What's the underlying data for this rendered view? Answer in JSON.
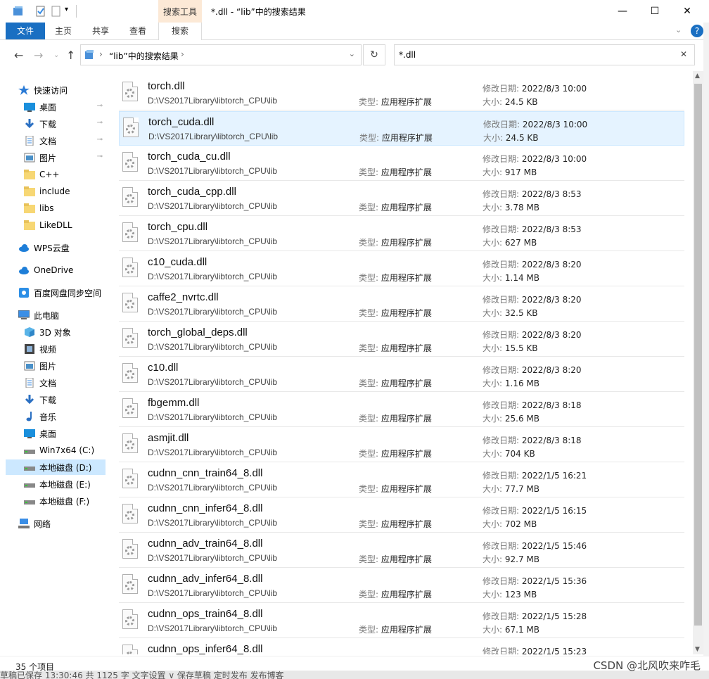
{
  "window": {
    "title": "*.dll - “lib”中的搜索结果",
    "context_tab": "搜索工具",
    "minimize": "—",
    "maximize": "☐",
    "close": "✕"
  },
  "ribbon": {
    "tabs": [
      "文件",
      "主页",
      "共享",
      "查看",
      "搜索"
    ]
  },
  "address": {
    "path": "“lib”中的搜索结果",
    "search_value": "*.dll"
  },
  "nav": {
    "items": [
      {
        "label": "快速访问",
        "icon": "star-icon"
      },
      {
        "label": "桌面",
        "icon": "desktop-icon",
        "pinned": true
      },
      {
        "label": "下载",
        "icon": "download-icon",
        "pinned": true
      },
      {
        "label": "文档",
        "icon": "document-icon",
        "pinned": true
      },
      {
        "label": "图片",
        "icon": "picture-icon",
        "pinned": true
      },
      {
        "label": "C++",
        "icon": "folder-icon"
      },
      {
        "label": "include",
        "icon": "folder-icon"
      },
      {
        "label": "libs",
        "icon": "folder-icon"
      },
      {
        "label": "LikeDLL",
        "icon": "folder-icon"
      },
      {
        "label": "WPS云盘",
        "icon": "cloud-icon"
      },
      {
        "label": "OneDrive",
        "icon": "cloud-icon"
      },
      {
        "label": "百度网盘同步空间",
        "icon": "sync-icon"
      },
      {
        "label": "此电脑",
        "icon": "computer-icon"
      },
      {
        "label": "3D 对象",
        "icon": "cube-icon"
      },
      {
        "label": "视频",
        "icon": "video-icon"
      },
      {
        "label": "图片",
        "icon": "picture-icon"
      },
      {
        "label": "文档",
        "icon": "document-icon"
      },
      {
        "label": "下载",
        "icon": "download-icon"
      },
      {
        "label": "音乐",
        "icon": "music-icon"
      },
      {
        "label": "桌面",
        "icon": "desktop-icon"
      },
      {
        "label": "Win7x64 (C:)",
        "icon": "drive-icon"
      },
      {
        "label": "本地磁盘 (D:)",
        "icon": "drive-icon",
        "selected": true
      },
      {
        "label": "本地磁盘 (E:)",
        "icon": "drive-icon"
      },
      {
        "label": "本地磁盘 (F:)",
        "icon": "drive-icon"
      },
      {
        "label": "网络",
        "icon": "network-icon"
      }
    ]
  },
  "labels": {
    "type": "类型:",
    "modified": "修改日期:",
    "size": "大小:"
  },
  "files": [
    {
      "name": "torch.dll",
      "path": "D:\\VS2017Library\\libtorch_CPU\\lib",
      "type": "应用程序扩展",
      "date": "2022/8/3 10:00",
      "size": "24.5 KB"
    },
    {
      "name": "torch_cuda.dll",
      "path": "D:\\VS2017Library\\libtorch_CPU\\lib",
      "type": "应用程序扩展",
      "date": "2022/8/3 10:00",
      "size": "24.5 KB",
      "highlighted": true
    },
    {
      "name": "torch_cuda_cu.dll",
      "path": "D:\\VS2017Library\\libtorch_CPU\\lib",
      "type": "应用程序扩展",
      "date": "2022/8/3 10:00",
      "size": "917 MB"
    },
    {
      "name": "torch_cuda_cpp.dll",
      "path": "D:\\VS2017Library\\libtorch_CPU\\lib",
      "type": "应用程序扩展",
      "date": "2022/8/3 8:53",
      "size": "3.78 MB"
    },
    {
      "name": "torch_cpu.dll",
      "path": "D:\\VS2017Library\\libtorch_CPU\\lib",
      "type": "应用程序扩展",
      "date": "2022/8/3 8:53",
      "size": "627 MB"
    },
    {
      "name": "c10_cuda.dll",
      "path": "D:\\VS2017Library\\libtorch_CPU\\lib",
      "type": "应用程序扩展",
      "date": "2022/8/3 8:20",
      "size": "1.14 MB"
    },
    {
      "name": "caffe2_nvrtc.dll",
      "path": "D:\\VS2017Library\\libtorch_CPU\\lib",
      "type": "应用程序扩展",
      "date": "2022/8/3 8:20",
      "size": "32.5 KB"
    },
    {
      "name": "torch_global_deps.dll",
      "path": "D:\\VS2017Library\\libtorch_CPU\\lib",
      "type": "应用程序扩展",
      "date": "2022/8/3 8:20",
      "size": "15.5 KB"
    },
    {
      "name": "c10.dll",
      "path": "D:\\VS2017Library\\libtorch_CPU\\lib",
      "type": "应用程序扩展",
      "date": "2022/8/3 8:20",
      "size": "1.16 MB"
    },
    {
      "name": "fbgemm.dll",
      "path": "D:\\VS2017Library\\libtorch_CPU\\lib",
      "type": "应用程序扩展",
      "date": "2022/8/3 8:18",
      "size": "25.6 MB"
    },
    {
      "name": "asmjit.dll",
      "path": "D:\\VS2017Library\\libtorch_CPU\\lib",
      "type": "应用程序扩展",
      "date": "2022/8/3 8:18",
      "size": "704 KB"
    },
    {
      "name": "cudnn_cnn_train64_8.dll",
      "path": "D:\\VS2017Library\\libtorch_CPU\\lib",
      "type": "应用程序扩展",
      "date": "2022/1/5 16:21",
      "size": "77.7 MB"
    },
    {
      "name": "cudnn_cnn_infer64_8.dll",
      "path": "D:\\VS2017Library\\libtorch_CPU\\lib",
      "type": "应用程序扩展",
      "date": "2022/1/5 16:15",
      "size": "702 MB"
    },
    {
      "name": "cudnn_adv_train64_8.dll",
      "path": "D:\\VS2017Library\\libtorch_CPU\\lib",
      "type": "应用程序扩展",
      "date": "2022/1/5 15:46",
      "size": "92.7 MB"
    },
    {
      "name": "cudnn_adv_infer64_8.dll",
      "path": "D:\\VS2017Library\\libtorch_CPU\\lib",
      "type": "应用程序扩展",
      "date": "2022/1/5 15:36",
      "size": "123 MB"
    },
    {
      "name": "cudnn_ops_train64_8.dll",
      "path": "D:\\VS2017Library\\libtorch_CPU\\lib",
      "type": "应用程序扩展",
      "date": "2022/1/5 15:28",
      "size": "67.1 MB"
    },
    {
      "name": "cudnn_ops_infer64_8.dll",
      "path": "D:\\VS2017Library\\libtorch_CPU\\lib",
      "type": "应用程序扩展",
      "date": "2022/1/5 15:23",
      "size": ""
    }
  ],
  "status": {
    "item_count": "35 个项目"
  },
  "bottom_strip": "草稿已保存 13:30:46    共 1125 字    文字设置 ∨        保存草稿        定时发布        发布博客",
  "watermark": "CSDN @北风吹来咋毛",
  "colors": {
    "accent": "#1a6fc2",
    "selection": "#cce8ff",
    "hover_row": "#e5f3ff",
    "context_tab": "#fce9d6"
  }
}
